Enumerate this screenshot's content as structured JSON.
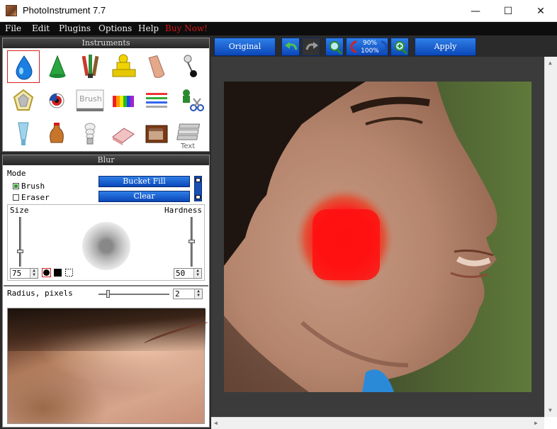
{
  "window": {
    "title": "PhotoInstrument 7.7",
    "controls": {
      "minimize": "—",
      "maximize": "☐",
      "close": "✕"
    }
  },
  "menu": [
    "File",
    "Edit",
    "Plugins",
    "Options",
    "Help",
    "Buy Now!"
  ],
  "instruments": {
    "header": "Instruments",
    "tools": [
      "blur-drop-icon",
      "sharpen-cone-icon",
      "paint-brushes-icon",
      "stamp-icon",
      "finger-smudge-icon",
      "pin-icon",
      "diamond-icon",
      "red-eye-icon",
      "brush-text-icon",
      "color-bars-icon",
      "color-lines-icon",
      "scissors-icon",
      "tube-icon",
      "vase-icon",
      "lamp-icon",
      "eraser-icon",
      "tv-icon",
      "text-stack-icon"
    ],
    "brush_tool_text": "Brush",
    "text_tool_text": "Text"
  },
  "blur": {
    "header": "Blur",
    "mode_label": "Mode",
    "brush_label": "Brush",
    "brush_checked": true,
    "eraser_label": "Eraser",
    "eraser_checked": false,
    "bucket_fill_label": "Bucket Fill",
    "clear_label": "Clear",
    "size_label": "Size",
    "hardness_label": "Hardness",
    "size_value": "75",
    "hardness_value": "50",
    "radius_label": "Radius, pixels",
    "radius_value": "2"
  },
  "toolbar": {
    "original_label": "Original",
    "apply_label": "Apply",
    "zoom_current": "90%",
    "zoom_fit": "100%"
  },
  "colors": {
    "accent_blue": "#1a5fd8",
    "menu_bg": "#0d0d0d",
    "buy_now": "#d41515",
    "panel_bg": "#2b2b2b",
    "blur_mask": "#ff1a1a"
  }
}
